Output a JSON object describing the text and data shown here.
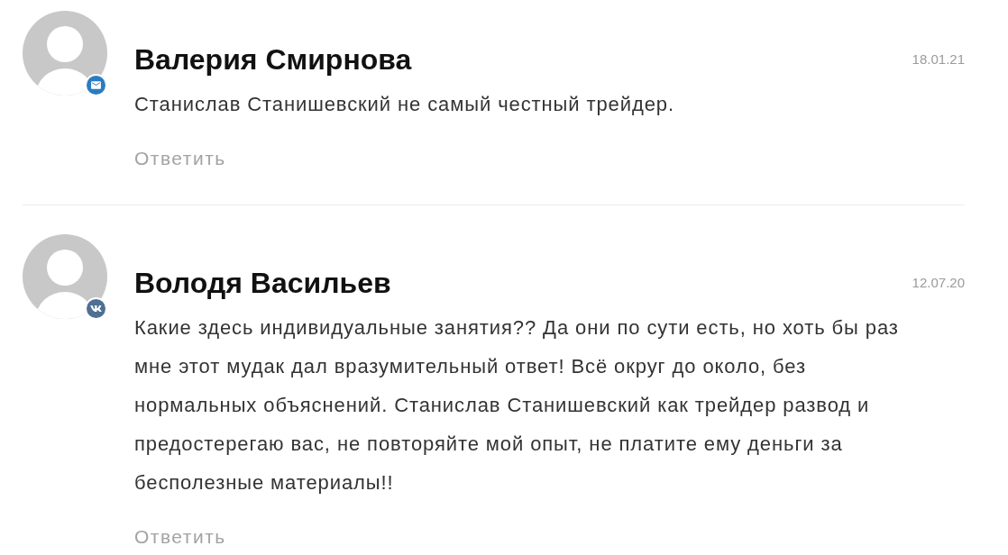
{
  "comments": [
    {
      "author": "Валерия Смирнова",
      "badge": {
        "kind": "email"
      },
      "date": "18.01.21",
      "text": "Станислав Станишевский не самый честный трейдер.",
      "reply": "Ответить"
    },
    {
      "author": "Володя Васильев",
      "badge": {
        "kind": "vk"
      },
      "date": "12.07.20",
      "text": "Какие здесь индивидуальные занятия?? Да они по сути есть, но хоть бы раз мне этот мудак дал вразумительный ответ! Всё округ до около, без нормальных объяснений. Станислав Станишевский как трейдер развод и предостерегаю вас, не повторяйте мой опыт, не платите ему деньги за бесполезные материалы!!",
      "reply": "Ответить"
    }
  ]
}
